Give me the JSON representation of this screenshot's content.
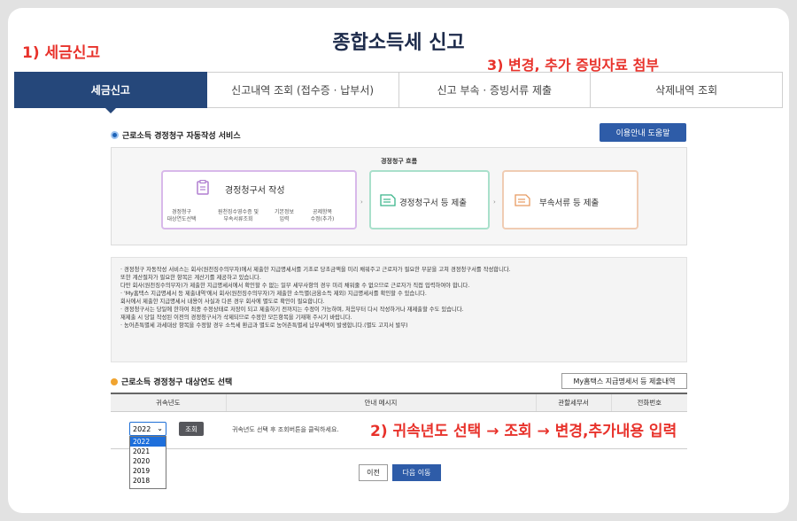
{
  "page_title": "종합소득세 신고",
  "annotations": {
    "a1": "1) 세금신고",
    "a2": "2) 귀속년도 선택 → 조회 → 변경,추가내용 입력",
    "a3": "3) 변경, 추가 증빙자료 첨부"
  },
  "tabs": [
    {
      "label": "세금신고",
      "active": true
    },
    {
      "label": "신고내역 조회 (접수증 · 납부서)"
    },
    {
      "label": "신고 부속 · 증빙서류 제출"
    },
    {
      "label": "삭제내역 조회"
    }
  ],
  "section1": {
    "title": "근로소득 경정청구 자동작성 서비스",
    "help_button": "이용안내 도움말",
    "flow_caption": "경정청구 흐름",
    "step1_label": "경정청구서 작성",
    "step1_subs": [
      "경정청구\n대상연도선택",
      "원천징수영수증 및\n부속서류조회",
      "기본정보\n입력",
      "공제항목\n수정(추가)"
    ],
    "step2_label": "경정청구서 등 제출",
    "step3_label": "부속서류 등 제출"
  },
  "notes": [
    "· 경정청구 자동작성 서비스는 회사(원천징수의무자)에서 제출한 지급명세서를 기초로 당초금액을 미리 채워주고 근로자가 필요한 부분을 고쳐 경정청구서를 작성합니다.",
    "  또한 계산절차가 필요한 항목은 계산기를 제공하고 있습니다.",
    "  다만 회사(원천징수의무자)가 제출한 지급명세서에서 확인할 수 없는 일부 세부사항의 경우 미리 채워줄 수 없으므로 근로자가 직접 입력하여야 합니다.",
    "· 'My홈택스 지급명세서 등 제출내역'에서 회사(원천징수의무자)가 제출한 소득별(금융소득 제외) 지급명세서를 확인할 수 있습니다.",
    "  회사에서 제출한 지급명세서 내용이 사실과 다른 경우 회사에 별도로 확인이 필요합니다.",
    "· 경정청구서는 당일에 한하여 최종 수정상태로 저장이 되고 제출하기 전까지는 수정이 가능하며, 처음부터 다시 작성하거나 재제출할 수도 있습니다.",
    "  재제출 시 당일 작성된 이전의 경정청구서가 삭제되므로 수정한 모든항목을 기재해 주시기 바랍니다.",
    "· 농어촌특별세 과세대상 항목을 수정할 경우 소득세 환급과 별도로 농어촌특별세 납부세액이 발생합니다.(별도 고지서 발부)"
  ],
  "section2": {
    "title": "근로소득 경정청구 대상연도 선택",
    "myhome_button": "My홈택스 지급명세서 등 제출내역",
    "columns": [
      "귀속년도",
      "안내 메시지",
      "관할세무서",
      "전화번호"
    ],
    "selected_year": "2022",
    "year_options": [
      "2022",
      "2021",
      "2020",
      "2019",
      "2018"
    ],
    "inquiry_button": "조회",
    "message": "귀속년도 선택 후 조회버튼을 클릭하세요."
  },
  "footer": {
    "prev": "이전",
    "next": "다음 이동"
  },
  "colors": {
    "primary": "#25477a",
    "button_blue": "#2e5ca8",
    "annotation": "#e8322b"
  }
}
